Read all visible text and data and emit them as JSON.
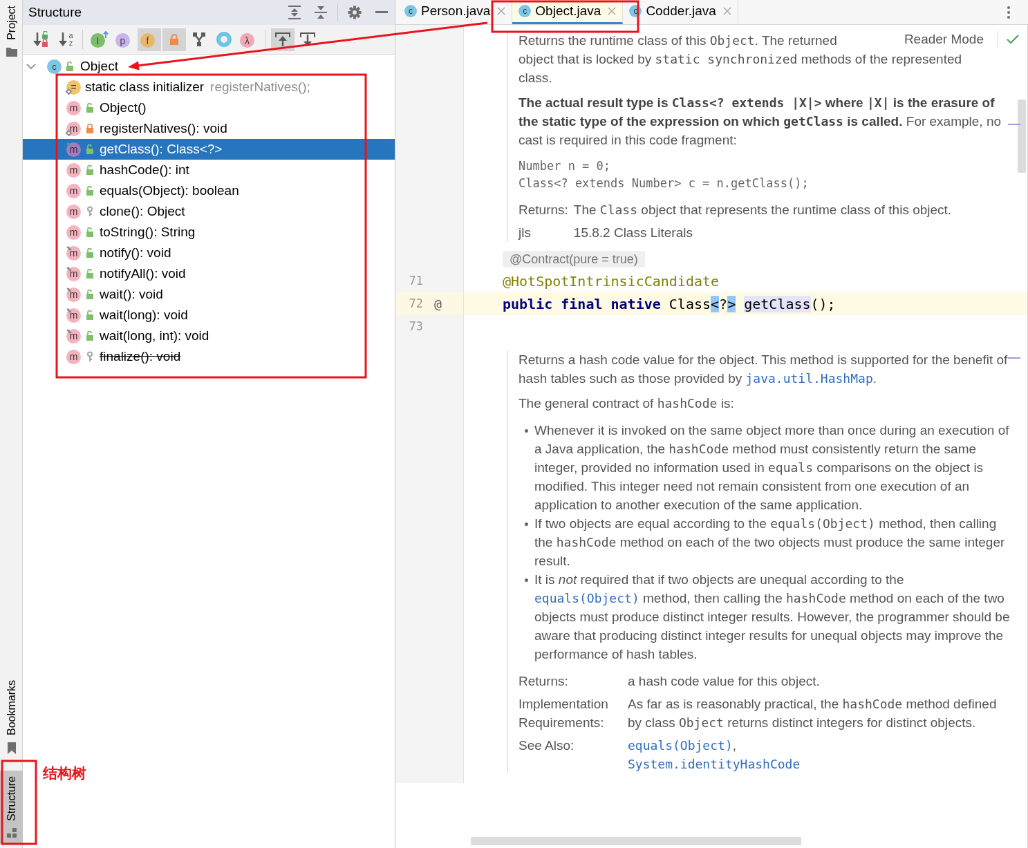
{
  "side_strip": {
    "top_tabs": [
      {
        "label": "Project",
        "kind": "folder",
        "selected": false
      }
    ],
    "bottom_tabs": [
      {
        "label": "Bookmarks",
        "kind": "bookmark",
        "selected": false
      },
      {
        "label": "Structure",
        "kind": "structure",
        "selected": true
      }
    ]
  },
  "structure": {
    "title": "Structure",
    "toolbar": [
      [
        {
          "kind": "sort_visibility",
          "selected": false
        },
        {
          "kind": "sort_alpha",
          "glyphs": [
            "a",
            "z"
          ],
          "selected": false
        }
      ],
      [
        {
          "kind": "inherited",
          "glyph": "I",
          "selected": false
        },
        {
          "kind": "properties",
          "glyph": "p",
          "selected": false
        },
        {
          "kind": "fields",
          "glyph": "f",
          "selected": true
        },
        {
          "kind": "non_public",
          "selected": true
        },
        {
          "kind": "grouping",
          "selected": false
        },
        {
          "kind": "anonymous",
          "selected": false
        },
        {
          "kind": "lambdas",
          "glyph": "λ",
          "selected": false
        }
      ],
      [
        {
          "kind": "autoscroll_to",
          "selected": true
        },
        {
          "kind": "autoscroll_from",
          "selected": false
        }
      ]
    ],
    "tree": {
      "label": "Object",
      "icon": "c",
      "kind": "public_class",
      "expanded": true,
      "children": [
        {
          "kind": "initializer",
          "icon": "=",
          "label": "static class initializer",
          "hint": "registerNatives();",
          "static": true,
          "final": false,
          "deprecated": false,
          "selected": false
        },
        {
          "kind": "public_method",
          "icon": "m",
          "label": "Object()",
          "static": false,
          "final": false,
          "deprecated": false,
          "selected": false
        },
        {
          "kind": "private_method",
          "icon": "m",
          "label": "registerNatives(): void",
          "static": true,
          "final": false,
          "deprecated": false,
          "selected": false
        },
        {
          "kind": "public_method",
          "icon": "m",
          "label": "getClass(): Class<?>",
          "static": false,
          "final": true,
          "deprecated": false,
          "selected": true
        },
        {
          "kind": "public_method",
          "icon": "m",
          "label": "hashCode(): int",
          "static": false,
          "final": false,
          "deprecated": false,
          "selected": false
        },
        {
          "kind": "public_method",
          "icon": "m",
          "label": "equals(Object): boolean",
          "static": false,
          "final": false,
          "deprecated": false,
          "selected": false
        },
        {
          "kind": "protected_method",
          "icon": "m",
          "label": "clone(): Object",
          "static": false,
          "final": false,
          "deprecated": false,
          "selected": false
        },
        {
          "kind": "public_method",
          "icon": "m",
          "label": "toString(): String",
          "static": false,
          "final": false,
          "deprecated": false,
          "selected": false
        },
        {
          "kind": "public_method",
          "icon": "m",
          "label": "notify(): void",
          "static": false,
          "final": true,
          "deprecated": false,
          "selected": false
        },
        {
          "kind": "public_method",
          "icon": "m",
          "label": "notifyAll(): void",
          "static": false,
          "final": true,
          "deprecated": false,
          "selected": false
        },
        {
          "kind": "public_method",
          "icon": "m",
          "label": "wait(): void",
          "static": false,
          "final": true,
          "deprecated": false,
          "selected": false
        },
        {
          "kind": "public_method",
          "icon": "m",
          "label": "wait(long): void",
          "static": false,
          "final": true,
          "deprecated": false,
          "selected": false
        },
        {
          "kind": "public_method",
          "icon": "m",
          "label": "wait(long, int): void",
          "static": false,
          "final": true,
          "deprecated": false,
          "selected": false
        },
        {
          "kind": "protected_method",
          "icon": "m",
          "label": "finalize(): void",
          "static": false,
          "final": false,
          "deprecated": true,
          "selected": false
        }
      ]
    }
  },
  "annotation": {
    "label": "结构树"
  },
  "editor": {
    "tabs": [
      {
        "label": "Person.java",
        "icon": "c",
        "selected": false
      },
      {
        "label": "Object.java",
        "icon": "c",
        "selected": true
      },
      {
        "label": "Codder.java",
        "icon": "c",
        "selected": false
      }
    ],
    "reader_mode": "Reader Mode",
    "rows": [
      {
        "kind": "doc",
        "blocks": [
          {
            "kind": "lines",
            "lines": [
              [
                "Returns the runtime class of this ",
                {
                  "text": "Object",
                  "kind": "code"
                },
                ". The returned"
              ],
              [
                "object that is locked by ",
                {
                  "text": "static synchronized",
                  "kind": "code"
                },
                " methods of the represented"
              ],
              [
                "class."
              ]
            ]
          },
          {
            "kind": "para",
            "segs": [
              {
                "text": "The actual result type is ",
                "kind": "bold"
              },
              {
                "text": "Class<? extends |X|>",
                "kind": "code_bold"
              },
              {
                "text": " where ",
                "kind": "bold"
              },
              {
                "text": "|X|",
                "kind": "code_bold"
              },
              {
                "text": " is the erasure of the static type of the expression on which ",
                "kind": "bold"
              },
              {
                "text": "getClass",
                "kind": "code_bold"
              },
              {
                "text": " is called.",
                "kind": "bold"
              },
              " For example, no cast is required in this code fragment:"
            ]
          },
          {
            "kind": "pre",
            "lines": [
              "Number n = 0;",
              "Class<? extends Number> c = n.getClass();"
            ]
          },
          {
            "kind": "table",
            "rows": [
              {
                "label": "Returns:",
                "lines": [
                  [
                    "The ",
                    {
                      "text": "Class",
                      "kind": "code"
                    },
                    " object that represents the runtime class of this object."
                  ]
                ]
              },
              {
                "label": "jls",
                "lines": [
                  [
                    "15.8.2 Class Literals"
                  ]
                ]
              }
            ]
          }
        ]
      },
      {
        "kind": "inlay",
        "text": "@Contract(pure = true)"
      },
      {
        "kind": "code",
        "number": "71",
        "current": false,
        "tokens": [
          {
            "text": "@HotSpotIntrinsicCandidate",
            "kind": "annotation",
            "gap_before": false
          }
        ]
      },
      {
        "kind": "code",
        "number": "72",
        "mark": "@",
        "current": true,
        "tokens": [
          {
            "text": "public final native",
            "kind": "keyword",
            "gap_before": false
          },
          {
            "text": " Class",
            "kind": "plain",
            "gap_before": false
          },
          {
            "text": "<",
            "kind": "brace",
            "gap_before": false
          },
          {
            "text": "?",
            "kind": "plain",
            "gap_before": false
          },
          {
            "text": ">",
            "kind": "brace",
            "gap_before": false
          },
          {
            "text": "getClass",
            "kind": "usage",
            "gap_before": true
          },
          {
            "text": "();",
            "kind": "plain",
            "gap_before": false
          }
        ]
      },
      {
        "kind": "code",
        "number": "73",
        "current": false,
        "tokens": []
      },
      {
        "kind": "doc",
        "blocks": [
          {
            "kind": "para",
            "segs": [
              "Returns a hash code value for the object. This method is supported for the benefit of hash tables such as those provided by ",
              {
                "text": "java.util.HashMap",
                "kind": "link"
              },
              "."
            ]
          },
          {
            "kind": "para",
            "segs": [
              "The general contract of ",
              {
                "text": "hashCode",
                "kind": "code"
              },
              " is:"
            ]
          },
          {
            "kind": "list",
            "items": [
              [
                "Whenever it is invoked on the same object more than once during an execution of a Java application, the ",
                {
                  "text": "hashCode",
                  "kind": "code"
                },
                " method must consistently return the same integer, provided no information used in ",
                {
                  "text": "equals",
                  "kind": "code"
                },
                " comparisons on the object is modified. This integer need not remain consistent from one execution of an application to another execution of the same application."
              ],
              [
                "If two objects are equal according to the ",
                {
                  "text": "equals(Object)",
                  "kind": "code"
                },
                " method, then calling the ",
                {
                  "text": "hashCode",
                  "kind": "code"
                },
                " method on each of the two objects must produce the same integer result."
              ],
              [
                "It is ",
                {
                  "text": "not",
                  "kind": "italic"
                },
                " required that if two objects are unequal according to the ",
                {
                  "text": "equals(Object)",
                  "kind": "link"
                },
                " method, then calling the ",
                {
                  "text": "hashCode",
                  "kind": "code"
                },
                " method on each of the two objects must produce distinct integer results. However, the programmer should be aware that producing distinct integer results for unequal objects may improve the performance of hash tables."
              ]
            ]
          },
          {
            "kind": "table",
            "rows": [
              {
                "label": "Returns:",
                "lines": [
                  [
                    "a hash code value for this object."
                  ]
                ]
              },
              {
                "label": "Implementation Requirements:",
                "lines": [
                  [
                    "As far as is reasonably practical, the ",
                    {
                      "text": "hashCode",
                      "kind": "code"
                    },
                    " method defined by class ",
                    {
                      "text": "Object",
                      "kind": "code"
                    },
                    " returns distinct integers for distinct objects."
                  ]
                ]
              },
              {
                "label": "See Also:",
                "lines": [
                  [
                    {
                      "text": "equals(Object)",
                      "kind": "link"
                    },
                    ","
                  ],
                  [
                    {
                      "text": "System.identityHashCode",
                      "kind": "link"
                    }
                  ]
                ]
              }
            ]
          }
        ]
      }
    ]
  }
}
